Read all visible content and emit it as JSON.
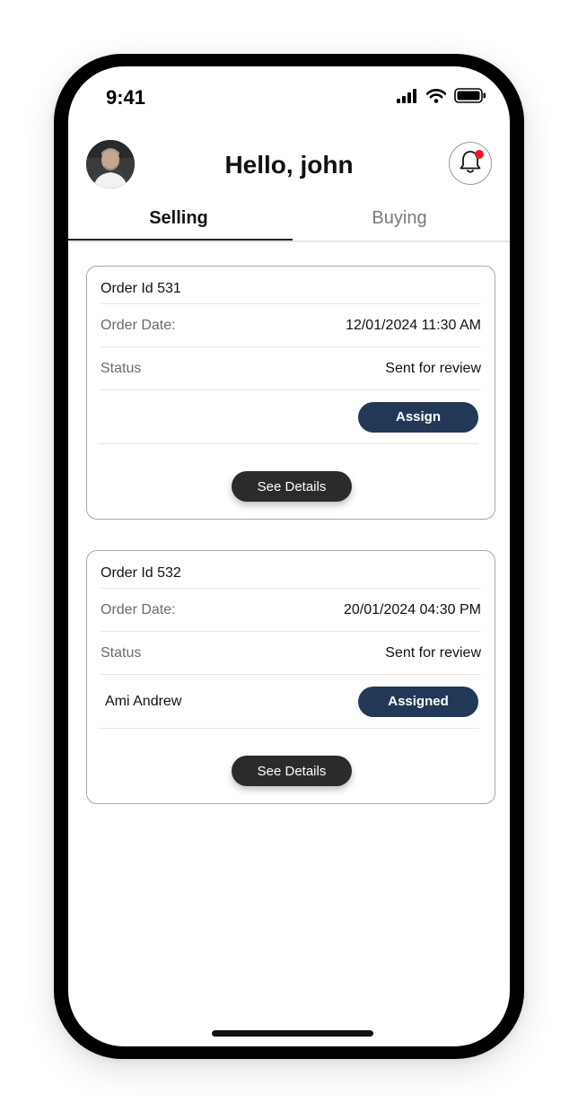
{
  "status_bar": {
    "time": "9:41"
  },
  "header": {
    "greeting": "Hello, john"
  },
  "tabs": [
    {
      "label": "Selling",
      "active": true
    },
    {
      "label": "Buying",
      "active": false
    }
  ],
  "orders": [
    {
      "order_id": "Order Id 531",
      "date_label": "Order Date:",
      "date_value": "12/01/2024 11:30 AM",
      "status_label": "Status",
      "status_value": "Sent for review",
      "assignee": "",
      "action_label": "Assign",
      "details_label": "See Details"
    },
    {
      "order_id": "Order Id 532",
      "date_label": "Order Date:",
      "date_value": "20/01/2024 04:30 PM",
      "status_label": "Status",
      "status_value": "Sent for review",
      "assignee": "Ami Andrew",
      "action_label": "Assigned",
      "details_label": "See Details"
    }
  ],
  "icons": {
    "signal": "cellular-signal-icon",
    "wifi": "wifi-icon",
    "battery": "battery-icon",
    "bell": "bell-icon"
  },
  "colors": {
    "accent": "#233856",
    "dark_button": "#2b2b2b",
    "notification": "#f0142a"
  }
}
